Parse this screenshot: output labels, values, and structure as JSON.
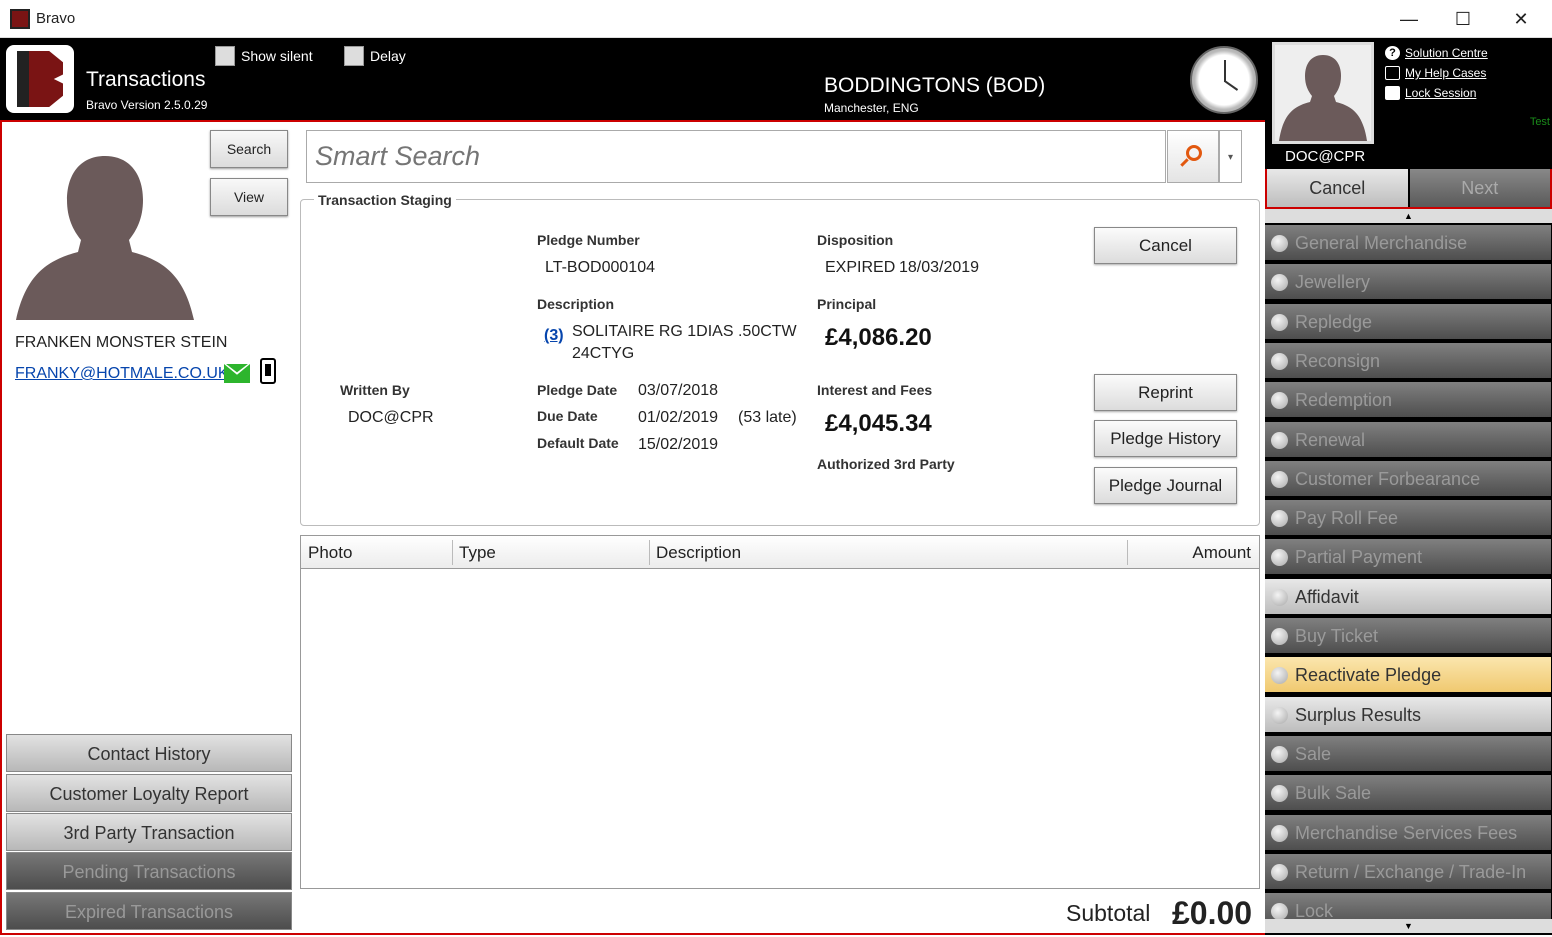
{
  "window": {
    "title": "Bravo",
    "minimize": "—",
    "maximize": "☐",
    "close": "✕"
  },
  "header": {
    "page_title": "Transactions",
    "version": "Bravo Version 2.5.0.29",
    "show_silent_label": "Show silent",
    "delay_label": "Delay",
    "store_name": "BODDINGTONS (BOD)",
    "store_location": "Manchester, ENG"
  },
  "user_panel": {
    "user_name": "DOC@CPR",
    "links": [
      {
        "label": "Solution Centre",
        "icon": "help-circle-icon"
      },
      {
        "label": "My Help Cases",
        "icon": "folder-icon"
      },
      {
        "label": "Lock Session",
        "icon": "lock-icon"
      }
    ],
    "env_label": "Test"
  },
  "nav": {
    "cancel": "Cancel",
    "next": "Next"
  },
  "customer": {
    "search_button": "Search",
    "view_button": "View",
    "name": "FRANKEN MONSTER STEIN",
    "email": "FRANKY@HOTMALE.CO.UK"
  },
  "left_menu": [
    {
      "label": "Contact History",
      "state": "enabled"
    },
    {
      "label": "Customer Loyalty Report",
      "state": "enabled"
    },
    {
      "label": "3rd Party Transaction",
      "state": "enabled"
    },
    {
      "label": "Pending Transactions",
      "state": "disabled"
    },
    {
      "label": "Expired Transactions",
      "state": "disabled"
    }
  ],
  "search": {
    "placeholder": "Smart Search",
    "dropdown": "▾"
  },
  "staging": {
    "title": "Transaction Staging",
    "pledge_number_label": "Pledge Number",
    "pledge_number": "LT-BOD000104",
    "disposition_label": "Disposition",
    "disposition_status": "EXPIRED",
    "disposition_date": "18/03/2019",
    "description_label": "Description",
    "description_count": "(3)",
    "description_text_line1": "SOLITAIRE RG 1DIAS .50CTW",
    "description_text_line2": "24CTYG",
    "principal_label": "Principal",
    "principal": "£4,086.20",
    "written_by_label": "Written By",
    "written_by": "DOC@CPR",
    "pledge_date_label": "Pledge Date",
    "pledge_date": "03/07/2018",
    "due_date_label": "Due Date",
    "due_date": "01/02/2019",
    "late_note": "(53 late)",
    "default_date_label": "Default Date",
    "default_date": "15/02/2019",
    "interest_label": "Interest and Fees",
    "interest": "£4,045.34",
    "authorized_label": "Authorized 3rd Party",
    "buttons": {
      "cancel": "Cancel",
      "reprint": "Reprint",
      "history": "Pledge History",
      "journal": "Pledge Journal"
    }
  },
  "table": {
    "columns": [
      "Photo",
      "Type",
      "Description",
      "Amount"
    ],
    "rows": []
  },
  "subtotal": {
    "label": "Subtotal",
    "value": "£0.00"
  },
  "right_menu": [
    {
      "label": "General Merchandise",
      "state": "disabled"
    },
    {
      "label": "Jewellery",
      "state": "disabled"
    },
    {
      "label": "Repledge",
      "state": "disabled"
    },
    {
      "label": "Reconsign",
      "state": "disabled"
    },
    {
      "label": "Redemption",
      "state": "disabled"
    },
    {
      "label": "Renewal",
      "state": "disabled"
    },
    {
      "label": "Customer Forbearance",
      "state": "disabled"
    },
    {
      "label": "Pay Roll Fee",
      "state": "disabled"
    },
    {
      "label": "Partial Payment",
      "state": "disabled"
    },
    {
      "label": "Affidavit",
      "state": "enabled"
    },
    {
      "label": "Buy Ticket",
      "state": "disabled"
    },
    {
      "label": "Reactivate Pledge",
      "state": "highlighted"
    },
    {
      "label": "Surplus Results",
      "state": "enabled"
    },
    {
      "label": "Sale",
      "state": "disabled"
    },
    {
      "label": "Bulk Sale",
      "state": "disabled"
    },
    {
      "label": "Merchandise Services Fees",
      "state": "disabled"
    },
    {
      "label": "Return / Exchange / Trade-In",
      "state": "disabled"
    },
    {
      "label": "Lock",
      "state": "disabled"
    }
  ]
}
